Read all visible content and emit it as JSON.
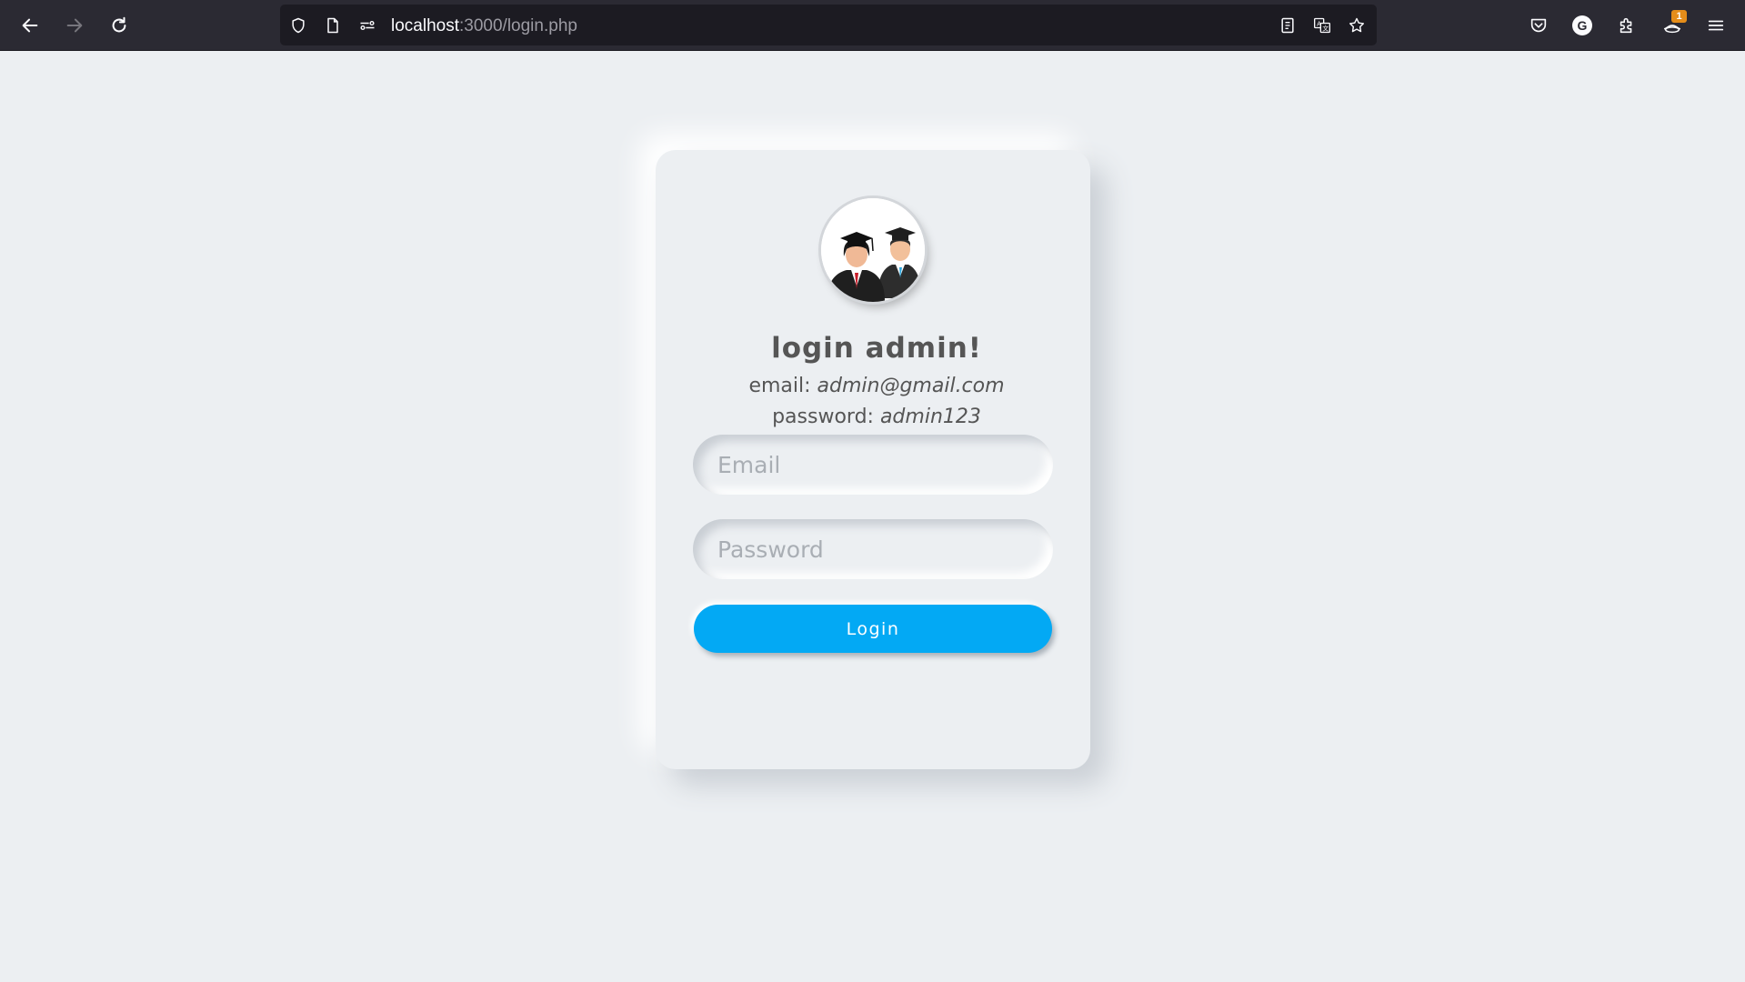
{
  "browser": {
    "url_host": "localhost",
    "url_path": ":3000/login.php",
    "extension_badge": "1",
    "account_initial": "G"
  },
  "login": {
    "title": "login admin!",
    "email_label": "email: ",
    "email_value": "admin@gmail.com",
    "password_label": "password: ",
    "password_value": "admin123",
    "email_placeholder": "Email",
    "password_placeholder": "Password",
    "button_label": "Login"
  },
  "colors": {
    "accent": "#03a9f4",
    "page_background": "#eceff2",
    "toolbar_background": "#2b2a33"
  }
}
